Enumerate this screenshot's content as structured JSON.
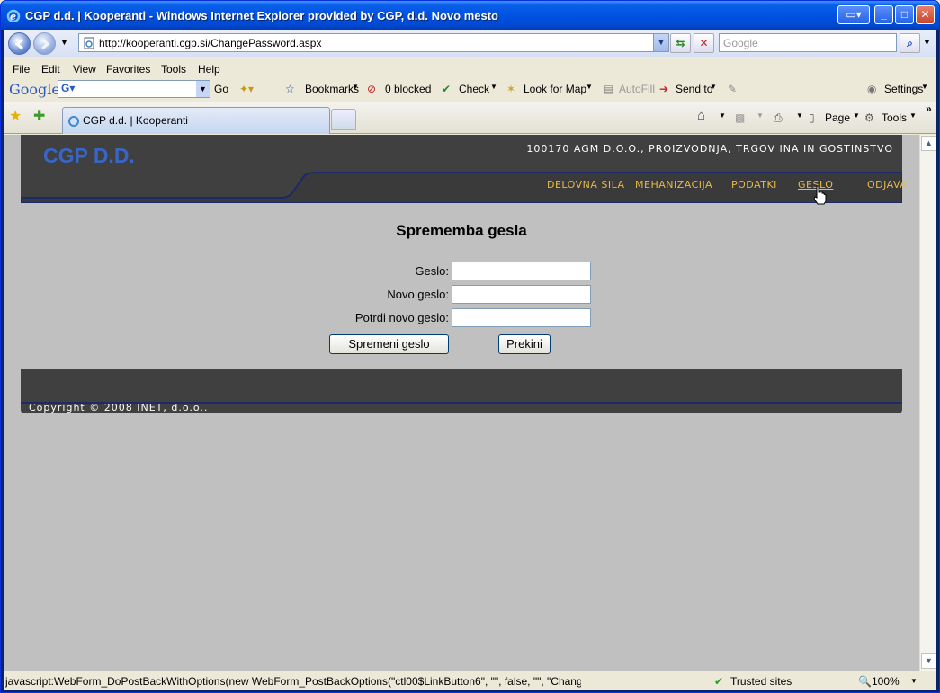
{
  "window": {
    "title": "CGP d.d. | Kooperanti - Windows Internet Explorer provided by CGP, d.d. Novo mesto"
  },
  "address": {
    "url": "http://kooperanti.cgp.si/ChangePassword.aspx",
    "search_placeholder": "Google"
  },
  "menu": [
    "File",
    "Edit",
    "View",
    "Favorites",
    "Tools",
    "Help"
  ],
  "google_toolbar": {
    "logo": "Google",
    "go": "Go",
    "bookmarks": "Bookmarks",
    "blocked": "0 blocked",
    "check": "Check",
    "look_for_map": "Look for Map",
    "autofill": "AutoFill",
    "send_to": "Send to",
    "settings": "Settings"
  },
  "tab": {
    "title": "CGP d.d. | Kooperanti"
  },
  "command_bar": {
    "page": "Page",
    "tools": "Tools"
  },
  "site": {
    "logo": "CGP D.D.",
    "company": "100170 AGM D.O.O., PROIZVODNJA, TRGOV INA IN GOSTINSTVO",
    "nav": [
      "DELOVNA SILA",
      "MEHANIZACIJA",
      "PODATKI",
      "GESLO",
      "ODJAVA"
    ],
    "footer": "Copyright © 2008 INET, d.o.o.."
  },
  "form": {
    "title": "Sprememba gesla",
    "label_password": "Geslo:",
    "label_new": "Novo geslo:",
    "label_confirm": "Potrdi novo geslo:",
    "submit": "Spremeni geslo",
    "cancel": "Prekini"
  },
  "status": {
    "text": "javascript:WebForm_DoPostBackWithOptions(new WebForm_PostBackOptions(\"ctl00$LinkButton6\", \"\", false, \"\", \"ChangePassword.a",
    "zone": "Trusted sites",
    "zoom": "100%"
  }
}
